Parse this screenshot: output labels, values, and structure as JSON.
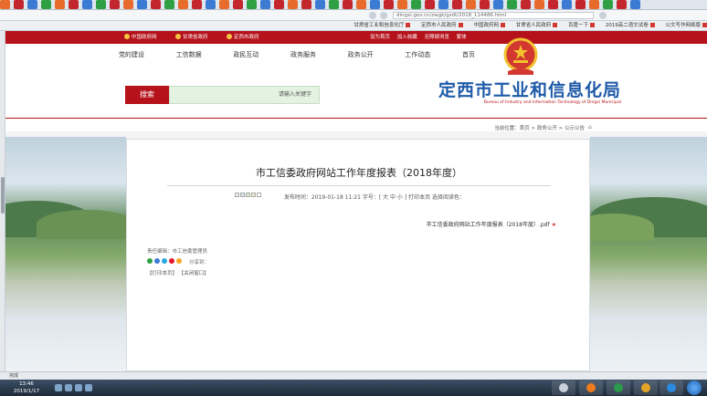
{
  "browser": {
    "address": "dingxi.gov.cn/zwgk/gzdt/2018_114486.html",
    "favorites": [
      "公文写作网络版",
      "2019高二语文试卷",
      "百度一下",
      "甘肃省人民政府",
      "中国政府网",
      "定西市人民政府",
      "甘肃省工业和信息化厅"
    ]
  },
  "site": {
    "top_links": [
      "中国政府网",
      "甘肃省政府",
      "定西市政府"
    ],
    "top_right": [
      "设为首页",
      "加入收藏",
      "无障碍浏览",
      "繁体"
    ],
    "title": "定西市工业和信息化局",
    "subtitle": "Bureau of Industry and Information Technology of Dingxi Municipal",
    "nav": [
      "首页",
      "工作动态",
      "政务公开",
      "政务服务",
      "政民互动",
      "工信数据",
      "党的建设"
    ],
    "search_button": "搜索",
    "search_placeholder": "请输入关键字",
    "breadcrumb": "当前位置：首页 > 政务公开 > 公示公告",
    "breadcrumb_icon": "home-icon"
  },
  "article": {
    "title": "市工信委政府网站工作年度报表（2018年度）",
    "meta": "发布时间：2019-01-18 11:21    字号：[ 大 中 小 ]    打印本页    选择阅读色：",
    "attachment": "市工信委政府网站工作年度报表（2018年度）.pdf",
    "footer_line": "责任编辑：市工信委管理员",
    "share_label": "分享到：",
    "footer_links": "【打印本页】  【关闭窗口】"
  },
  "status": {
    "text": "完成"
  },
  "taskbar": {
    "time": "13:46",
    "date": "2019/1/17"
  },
  "colors": {
    "brand_red": "#b5121b",
    "title_blue": "#1e5aa8",
    "search_green": "#e3f2e1"
  }
}
